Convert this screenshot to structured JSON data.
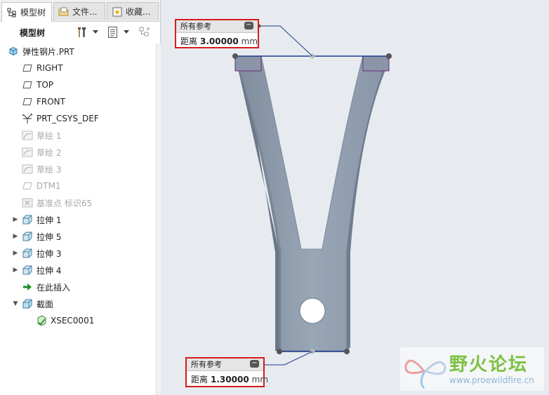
{
  "tabs": [
    {
      "label": "模型树",
      "icon": "model-tree-icon"
    },
    {
      "label": "文件...",
      "icon": "folder-icon"
    },
    {
      "label": "收藏...",
      "icon": "favorites-icon"
    }
  ],
  "toolbar": {
    "title": "模型树",
    "icons": [
      "settings-tools-icon",
      "tree-filter-icon",
      "columns-icon"
    ]
  },
  "tree": {
    "root": "弹性钢片.PRT",
    "items": [
      {
        "label": "RIGHT",
        "type": "plane"
      },
      {
        "label": "TOP",
        "type": "plane"
      },
      {
        "label": "FRONT",
        "type": "plane"
      },
      {
        "label": "PRT_CSYS_DEF",
        "type": "csys"
      },
      {
        "label": "草绘 1",
        "type": "sketch"
      },
      {
        "label": "草绘 2",
        "type": "sketch"
      },
      {
        "label": "草绘 3",
        "type": "sketch"
      },
      {
        "label": "DTM1",
        "type": "plane"
      },
      {
        "label": "基准点 标识65",
        "type": "point"
      },
      {
        "label": "拉伸 1",
        "type": "extrude"
      },
      {
        "label": "拉伸 5",
        "type": "extrude"
      },
      {
        "label": "拉伸 3",
        "type": "extrude"
      },
      {
        "label": "拉伸 4",
        "type": "extrude"
      },
      {
        "label": "在此插入",
        "type": "insert"
      },
      {
        "label": "截面",
        "type": "section"
      },
      {
        "label": "XSEC0001",
        "type": "xsec"
      }
    ]
  },
  "dimensions": {
    "top": {
      "header": "所有参考",
      "label": "距离",
      "value": "3.00000",
      "unit": "mm"
    },
    "bottom": {
      "header": "所有参考",
      "label": "距离",
      "value": "1.30000",
      "unit": "mm"
    }
  },
  "watermark": {
    "title": "野火论坛",
    "url": "www.proewildfire.cn"
  },
  "colors": {
    "accent": "#d41c1c",
    "part": "#8e9db0",
    "ref": "#1e3a8a",
    "handle": "#555555"
  }
}
